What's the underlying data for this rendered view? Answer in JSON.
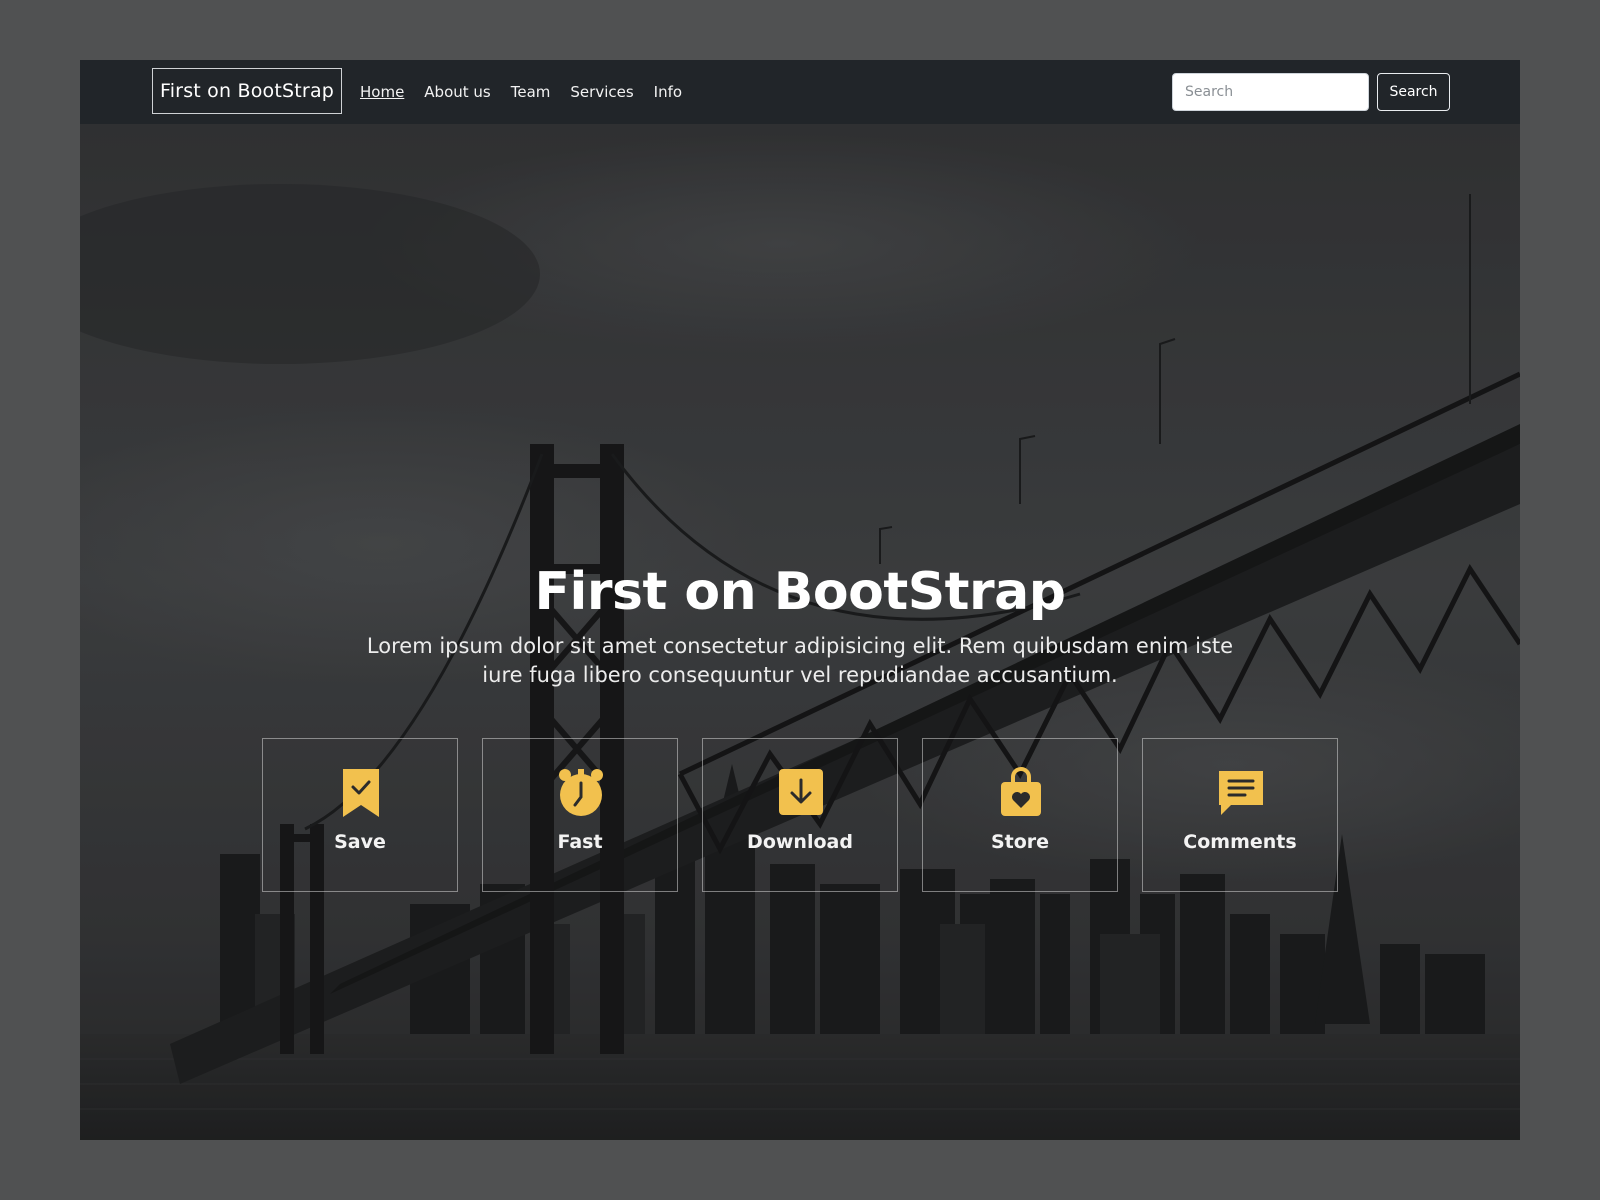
{
  "navbar": {
    "brand": "First on BootStrap",
    "links": [
      {
        "label": "Home",
        "active": true
      },
      {
        "label": "About us"
      },
      {
        "label": "Team"
      },
      {
        "label": "Services"
      },
      {
        "label": "Info"
      }
    ],
    "search": {
      "placeholder": "Search",
      "value": "",
      "button_label": "Search"
    }
  },
  "hero": {
    "title": "First on BootStrap",
    "text": "Lorem ipsum dolor sit amet consectetur adipisicing elit. Rem quibusdam enim iste iure fuga libero consequuntur vel repudiandae accusantium.",
    "features": [
      {
        "label": "Save",
        "icon": "bookmark-check-icon"
      },
      {
        "label": "Fast",
        "icon": "alarm-clock-icon"
      },
      {
        "label": "Download",
        "icon": "download-icon"
      },
      {
        "label": "Store",
        "icon": "shopping-bag-heart-icon"
      },
      {
        "label": "Comments",
        "icon": "comment-icon"
      }
    ]
  },
  "colors": {
    "accent": "#f2c14e",
    "navbar_bg": "#212529",
    "page_bg": "#505152"
  }
}
